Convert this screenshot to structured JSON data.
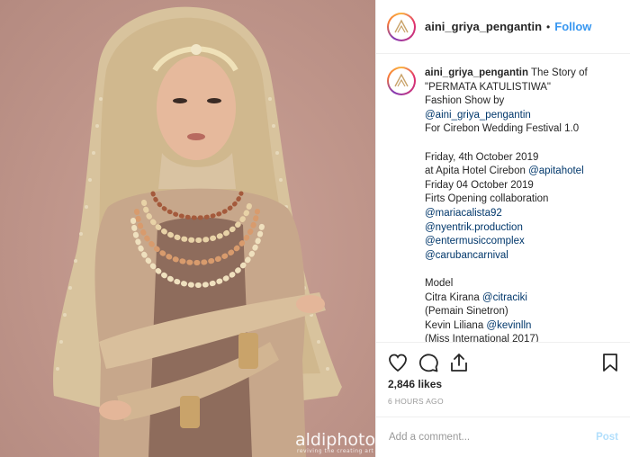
{
  "post": {
    "username": "aini_griya_pengantin",
    "follow_label": "Follow",
    "dot": "•",
    "watermark": "aldiphoto",
    "watermark_sub": "reviving the creating art"
  },
  "caption": {
    "username": "aini_griya_pengantin",
    "lines": [
      {
        "text": " The Story of",
        "type": "text"
      },
      {
        "text": "\"PERMATA KATULISTIWA\"",
        "type": "text"
      },
      {
        "text": "Fashion Show by",
        "type": "text"
      },
      {
        "text": "@aini_griya_pengantin",
        "type": "mention"
      },
      {
        "text": "For Cirebon Wedding Festival 1.0",
        "type": "text"
      },
      {
        "text": "",
        "type": "gap"
      },
      {
        "text": "Friday, 4th October 2019",
        "type": "text"
      },
      {
        "text": "at Apita Hotel Cirebon ",
        "type": "text",
        "mention": "@apitahotel"
      },
      {
        "text": "Friday 04 October 2019",
        "type": "text"
      },
      {
        "text": "Firts Opening collaboration",
        "type": "text"
      },
      {
        "text": "@mariacalista92",
        "type": "mention"
      },
      {
        "text": "@nyentrik.production",
        "type": "mention"
      },
      {
        "text": "@entermusiccomplex",
        "type": "mention"
      },
      {
        "text": "@carubancarnival",
        "type": "mention"
      },
      {
        "text": "",
        "type": "gap"
      },
      {
        "text": "Model",
        "type": "text"
      },
      {
        "text": "Citra Kirana ",
        "type": "text",
        "mention": "@citraciki"
      },
      {
        "text": "(Pemain Sinetron)",
        "type": "text"
      },
      {
        "text": "Kevin Liliana ",
        "type": "text",
        "mention": "@kevinlln"
      },
      {
        "text": "(Miss International 2017)",
        "type": "text"
      }
    ]
  },
  "stats": {
    "likes": "2,846 likes",
    "time": "6 HOURS AGO"
  },
  "comment": {
    "placeholder": "Add a comment...",
    "post_label": "Post"
  },
  "icons": {
    "like": "heart-icon",
    "comment": "comment-icon",
    "share": "share-icon",
    "save": "bookmark-icon"
  },
  "colors": {
    "link": "#3897f0",
    "mention": "#00376b",
    "post_disabled": "#b2dffc",
    "photo_bg": "#bf958a"
  }
}
